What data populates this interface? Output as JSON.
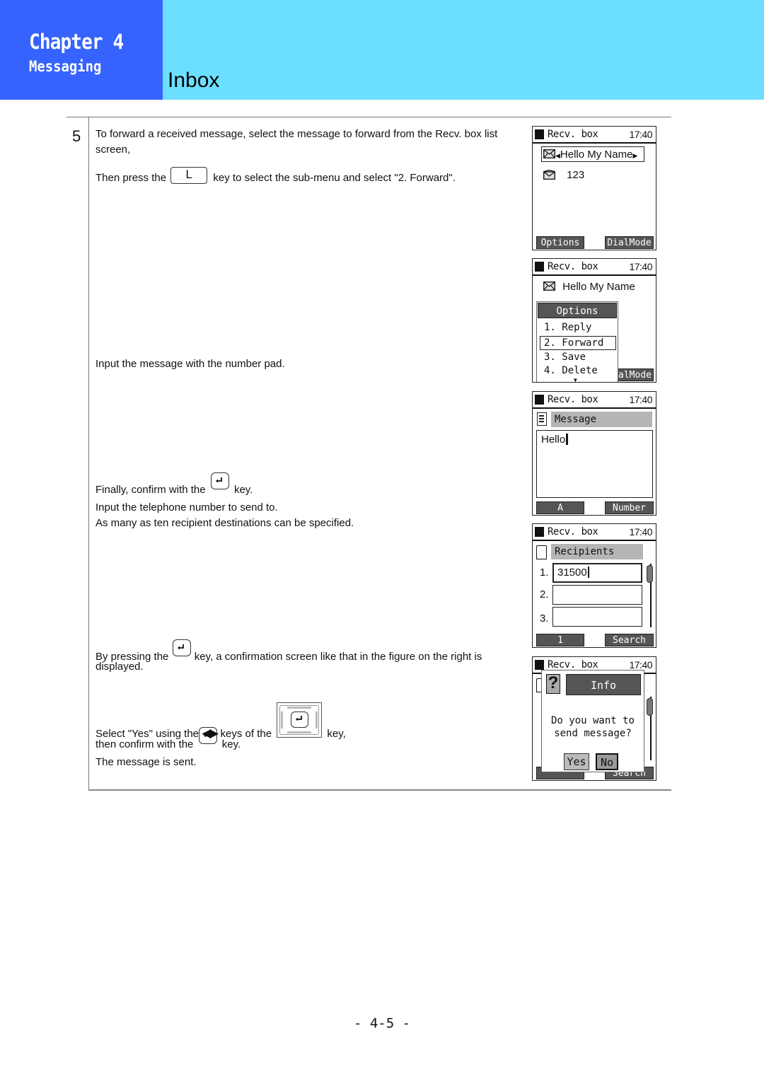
{
  "header": {
    "chapter": "Chapter 4",
    "chapter_subtitle": "Messaging",
    "section_title": "Inbox",
    "colors": {
      "chapter_bg": "#3663fd",
      "section_bg": "#6cdffe"
    }
  },
  "step": {
    "number": "5",
    "paragraphs": {
      "p1": "To forward a received message, select the message to forward from the Recv. box list",
      "p1b": "screen,",
      "p2_before": "Then press the",
      "p2_key": "L",
      "p2_after": "key to select the sub-menu and select \"2. Forward\".",
      "p3": "Input the message with the number pad.",
      "p4_before": "Finally, confirm with the",
      "p4_after": "key.",
      "p5": "Input the telephone number to send to.",
      "p6": "As many as ten recipient destinations can be specified.",
      "p7_before": "By pressing the",
      "p7_after": "key, a confirmation screen like that in the figure on the right is",
      "p7b": "displayed.",
      "p8_before": "Select \"Yes\" using the",
      "p8_arrows": "◀▶",
      "p8_mid": "keys of the",
      "p8_after": "key,",
      "p9_before": "then confirm with the",
      "p9_after": "key.",
      "p10": "The message is sent."
    }
  },
  "screens": [
    {
      "title": "Recv. box",
      "time": "17:40",
      "items": [
        "Hello My Name",
        "123"
      ],
      "softkeys": {
        "left": "Options",
        "right": "DialMode"
      }
    },
    {
      "title": "Recv. box",
      "time": "17:40",
      "item": "Hello My Name",
      "menu": {
        "title": "Options",
        "items": [
          "1. Reply",
          "2. Forward",
          "3. Save",
          "4. Delete"
        ],
        "selected": "2. Forward"
      },
      "softkeys": {
        "right": "alMode"
      }
    },
    {
      "title": "Recv. box",
      "time": "17:40",
      "header": "Message",
      "text": "Hello",
      "softkeys": {
        "left": "A",
        "right": "Number"
      }
    },
    {
      "title": "Recv. box",
      "time": "17:40",
      "header": "Recipients",
      "rows": [
        {
          "num": "1.",
          "value": "31500"
        },
        {
          "num": "2.",
          "value": ""
        },
        {
          "num": "3.",
          "value": ""
        }
      ],
      "softkeys": {
        "left": "1",
        "right": "Search"
      }
    },
    {
      "title": "Recv. box",
      "time": "17:40",
      "dialog": {
        "title": "Info",
        "icon": "?",
        "line1": "Do you want to",
        "line2": "send message?",
        "yes": "Yes",
        "no": "No"
      },
      "softkeys": {
        "right": "Search"
      }
    }
  ],
  "footer": {
    "page_number": "- 4-5 -"
  }
}
